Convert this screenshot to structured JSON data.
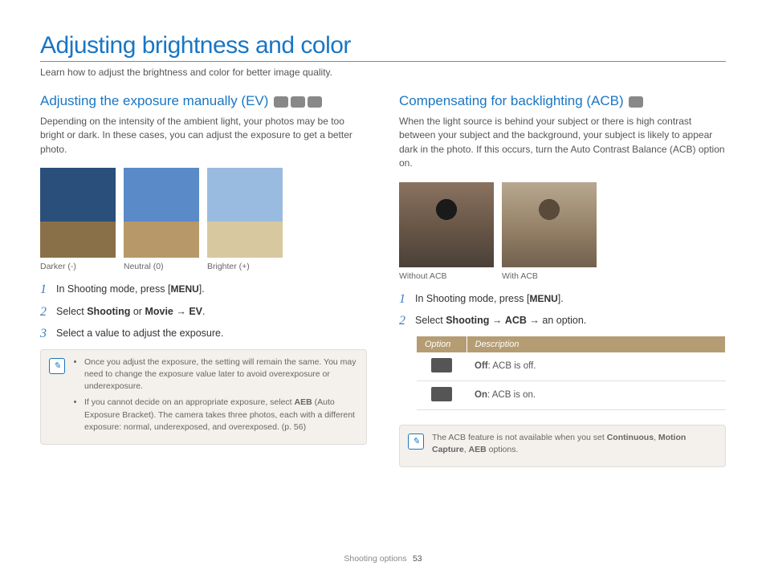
{
  "page": {
    "title": "Adjusting brightness and color",
    "intro": "Learn how to adjust the brightness and color for better image quality.",
    "footer_section": "Shooting options",
    "page_number": "53"
  },
  "left": {
    "heading": "Adjusting the exposure manually (EV)",
    "body": "Depending on the intensity of the ambient light, your photos may be too bright or dark. In these cases, you can adjust the exposure to get a better photo.",
    "captions": {
      "c1": "Darker (-)",
      "c2": "Neutral (0)",
      "c3": "Brighter (+)"
    },
    "steps": {
      "s1a": "In Shooting mode, press [",
      "s1menu": "MENU",
      "s1b": "].",
      "s2a": "Select ",
      "s2b": "Shooting",
      "s2c": " or ",
      "s2d": "Movie",
      "s2e": " → ",
      "s2f": "EV",
      "s2g": ".",
      "s3": "Select a value to adjust the exposure."
    },
    "notes": {
      "n1": "Once you adjust the exposure, the setting will remain the same. You may need to change the exposure value later to avoid overexposure or underexposure.",
      "n2a": "If you cannot decide on an appropriate exposure, select ",
      "n2b": "AEB",
      "n2c": " (Auto Exposure Bracket). The camera takes three photos, each with a different exposure: normal, underexposed, and overexposed. (p. 56)"
    }
  },
  "right": {
    "heading": "Compensating for backlighting (ACB)",
    "body": "When the light source is behind your subject or there is high contrast between your subject and the background, your subject is likely to appear dark in the photo. If this occurs, turn the Auto Contrast Balance (ACB) option on.",
    "captions": {
      "c1": "Without ACB",
      "c2": "With ACB"
    },
    "steps": {
      "s1a": "In Shooting mode, press [",
      "s1menu": "MENU",
      "s1b": "].",
      "s2a": "Select ",
      "s2b": "Shooting",
      "s2c": " → ",
      "s2d": "ACB",
      "s2e": " → an option."
    },
    "table": {
      "th1": "Option",
      "th2": "Description",
      "r1b": "Off",
      "r1d": ": ACB is off.",
      "r2b": "On",
      "r2d": ": ACB is on."
    },
    "note": {
      "a": "The ACB feature is not available when you set ",
      "b": "Continuous",
      "c": ", ",
      "d": "Motion Capture",
      "e": ", ",
      "f": "AEB",
      "g": " options."
    }
  }
}
